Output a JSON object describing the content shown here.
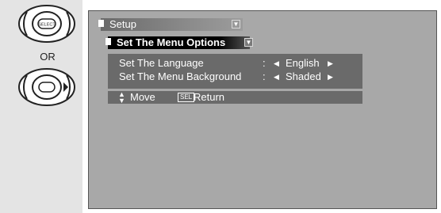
{
  "instructions": {
    "or_label": "OR",
    "select_button_label": "SELECT"
  },
  "setup_menu": {
    "title": "Setup",
    "submenu_title": "Set The Menu Options",
    "settings": [
      {
        "label": "Set The Language",
        "value": "English"
      },
      {
        "label": "Set The Menu Background",
        "value": "Shaded"
      }
    ],
    "help": {
      "move": "Move",
      "sel_key": "SEL",
      "return": "Return"
    }
  },
  "colors": {
    "left_panel_bg": "#e4e4e4",
    "screen_bg": "#a8a8a8",
    "menu_panel_bg": "#6a6a6a",
    "selected_bar_bg": "#000000"
  }
}
